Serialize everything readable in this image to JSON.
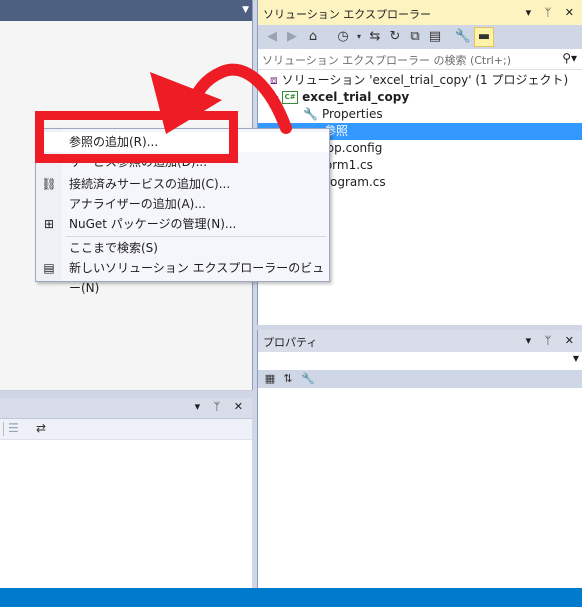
{
  "solution_explorer": {
    "title": "ソリューション エクスプローラー",
    "window_buttons": "▾ ᛘ ✕",
    "search_placeholder": "ソリューション エクスプローラー の検索 (Ctrl+;)",
    "tree": [
      {
        "label": "ソリューション 'excel_trial_copy' (1 プロジェクト)",
        "icon": "solution-icon"
      },
      {
        "label": "excel_trial_copy",
        "icon": "csharp-project-icon",
        "bold": true
      },
      {
        "label": "Properties",
        "icon": "wrench-icon"
      },
      {
        "label": "参照",
        "icon": "references-icon",
        "selected": true
      },
      {
        "label": "App.config",
        "icon": "config-file-icon"
      },
      {
        "label": "Form1.cs",
        "icon": "form-icon"
      },
      {
        "label": "Program.cs",
        "icon": "csharp-file-icon"
      }
    ],
    "cs_badge": "C#"
  },
  "properties": {
    "title": "プロパティ",
    "window_buttons": "▾ ᛘ ✕"
  },
  "bottom_left": {
    "window_buttons": "▾ ᛘ ✕"
  },
  "context_menu": {
    "items": [
      {
        "label": "参照の追加(R)...",
        "icon": ""
      },
      {
        "label": "サービス参照の追加(D)...",
        "icon": ""
      },
      {
        "label": "接続済みサービスの追加(C)...",
        "icon": "connected-service-icon"
      },
      {
        "label": "アナライザーの追加(A)...",
        "icon": ""
      },
      {
        "label": "NuGet パッケージの管理(N)...",
        "icon": "nuget-icon"
      },
      {
        "label": "ここまで検索(S)",
        "icon": ""
      },
      {
        "label": "新しいソリューション エクスプローラーのビュー(N)",
        "icon": "new-view-icon"
      }
    ]
  },
  "colors": {
    "accent_blue": "#007acc",
    "selection": "#3399ff",
    "annotation_red": "#ee1c24",
    "active_title": "#fcf3c1"
  }
}
